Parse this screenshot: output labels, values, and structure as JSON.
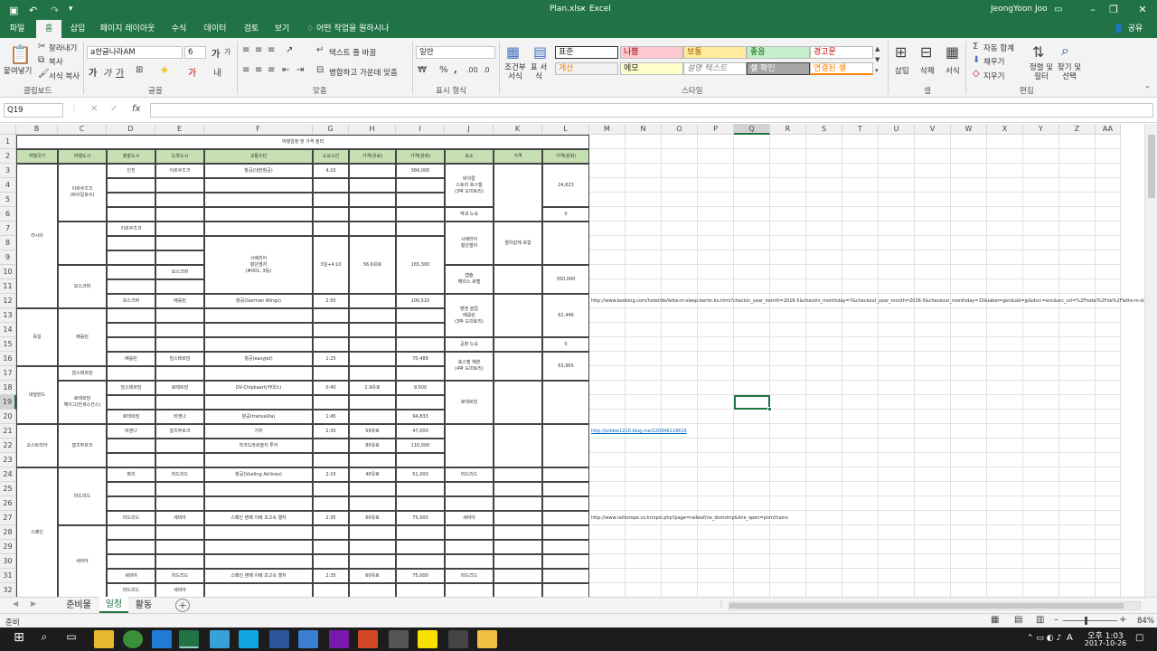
{
  "titlebar": {
    "filename": "Plan.xlsx",
    "sep": "-",
    "app": "Excel",
    "user": "JeongYoon Joo"
  },
  "menu": {
    "tabs": [
      "파일",
      "홈",
      "삽입",
      "페이지 레이아웃",
      "수식",
      "데이터",
      "검토",
      "보기"
    ],
    "tell_me": "어떤 작업을 원하시나요?",
    "share": "공유"
  },
  "ribbon": {
    "clipboard": {
      "paste": "붙여넣기",
      "cut": "잘라내기",
      "copy": "복사",
      "format_painter": "서식 복사",
      "group": "클립보드"
    },
    "font": {
      "name": "a한글나라AM",
      "size": "6",
      "group": "글꼴"
    },
    "align": {
      "wrap": "텍스트 줄 바꿈",
      "merge": "병합하고 가운데 맞춤",
      "group": "맞춤"
    },
    "number": {
      "format": "일반",
      "group": "표시 형식"
    },
    "styles": {
      "cond": "조건부 서식",
      "table": "표 서식",
      "normal": "표준",
      "bad": "나쁨",
      "neutral": "보통",
      "good": "좋음",
      "warning": "경고문",
      "calc": "계산",
      "memo": "메모",
      "explan": "설명 텍스트",
      "check": "셀 확인",
      "linked": "연결된 셀",
      "group": "스타일"
    },
    "cells": {
      "insert": "삽입",
      "delete": "삭제",
      "format": "서식",
      "group": "셀"
    },
    "editing": {
      "autosum": "자동 합계",
      "fill": "채우기",
      "clear": "지우기",
      "sort": "정렬 및 필터",
      "find": "찾기 및 선택",
      "group": "편집"
    }
  },
  "formula": {
    "namebox": "Q19",
    "fx": "fx"
  },
  "columns": [
    "B",
    "C",
    "D",
    "E",
    "F",
    "G",
    "H",
    "I",
    "J",
    "K",
    "L",
    "M",
    "N",
    "O",
    "P",
    "Q",
    "R",
    "S",
    "T",
    "U",
    "V",
    "W",
    "X",
    "Y",
    "Z",
    "AA"
  ],
  "rows": [
    "1",
    "2",
    "3",
    "4",
    "5",
    "6",
    "7",
    "8",
    "9",
    "10",
    "11",
    "12",
    "13",
    "14",
    "15",
    "16",
    "17",
    "18",
    "19",
    "20",
    "21",
    "22",
    "23",
    "24",
    "25",
    "26",
    "27",
    "28",
    "29",
    "30",
    "31",
    "32"
  ],
  "table": {
    "title": "여행일정 및 가격 정리",
    "headers": [
      "여행국가",
      "여행도시",
      "출발도시",
      "도착도시",
      "교통수단",
      "소요시간",
      "가격(유로)",
      "가격(원화)",
      "숙소",
      "가격",
      "가격(원화)"
    ],
    "countries": [
      "러시아",
      "독일",
      "네덜란드",
      "오스트리아",
      "스페인"
    ],
    "cities": [
      "이르쿠츠크\n(바이칼호수)",
      "모스크바",
      "베를린",
      "암스테르담",
      "로테르담\n헤이그(잔세스칸스)",
      "잘츠부르크",
      "마드리드",
      "세비야"
    ],
    "depart": [
      "인천",
      "이르쿠츠크",
      "모스크바",
      "베를린",
      "암스테르담",
      "로테르담",
      "비엔나",
      "파리",
      "마드리드",
      "세비야",
      "마드리드"
    ],
    "arrive": [
      "이르쿠츠크",
      "모스크바",
      "베를린",
      "암스테르담",
      "로테르담",
      "비엔나",
      "잘츠부르크",
      "마드리드",
      "세비야",
      "마드리드",
      "세비야"
    ],
    "transport": [
      "항공(대한항공)",
      "시베리아\n횡단열차\n(#001, 3등)",
      "항공(German Wings)",
      "항공(easyJet)",
      "OV-Chipkaart(카대스)",
      "항공(transaVia)",
      "기차",
      "자크드라르참지 투어",
      "항공(Vueling Airlines)",
      "스페인 렌페 이베 초고속 열차",
      "스페인 렌페 이베 초고속 열차"
    ],
    "time": [
      "4:10",
      "3일+4:10",
      "2:50",
      "1:25",
      "0:40",
      "1:45",
      "2:30",
      "2:10",
      "2:35",
      "2:35"
    ],
    "eur": [
      "56.6유로",
      "2.9유로",
      "59유로",
      "85유로",
      "40유로",
      "60유로",
      "60유로"
    ],
    "krw": [
      "384,000",
      "165,300",
      "100,510",
      "70,488",
      "9,500",
      "94,833",
      "47,000",
      "110,000",
      "51,000",
      "75,000",
      "75,000"
    ],
    "lodging": [
      "바이칼\n스토리 호스텔\n(3박 도미토리)",
      "역내 노숙",
      "시베리아\n횡단열차",
      "캡슐\n해리스 호텔",
      "벤엔 슬립\n베를린\n(3박 도미토리)",
      "공항 노숙",
      "호스텔 헤븐\n(4박 도미토리)",
      "로테르담",
      "마드리드",
      "세비야",
      "마드리드"
    ],
    "lodging_price": "열차값에 포함",
    "lodging_krw": [
      "24,623",
      "0",
      "350,000",
      "62,446",
      "0",
      "63,965"
    ],
    "urls": [
      "http://www.booking.com/hotel/de/lette-m-sleep-berlin.ko.html?checkin_year_month=2016-5&checkin_monthday=7&checkout_year_month=2016-5&checkout_monthday=10&label=gen&sid=jp&dsrc=enc&src_url=%2Fhotel%2Fde%2Flette-m-sleep-berlin.ko.html%3Faid%3D304142",
      "http://orbbio1210.blog.me/220346119616",
      "http://www.railtorope.co.kr/opsl.php?page=railwaf/ne_domstrip&line_open=pnm/trains"
    ]
  },
  "sheets": [
    "준비물",
    "일정",
    "활동"
  ],
  "status": {
    "ready": "준비",
    "zoom": "84%"
  },
  "taskbar": {
    "time": "오후 1:03",
    "date": "2017-10-26",
    "lang": "A"
  }
}
